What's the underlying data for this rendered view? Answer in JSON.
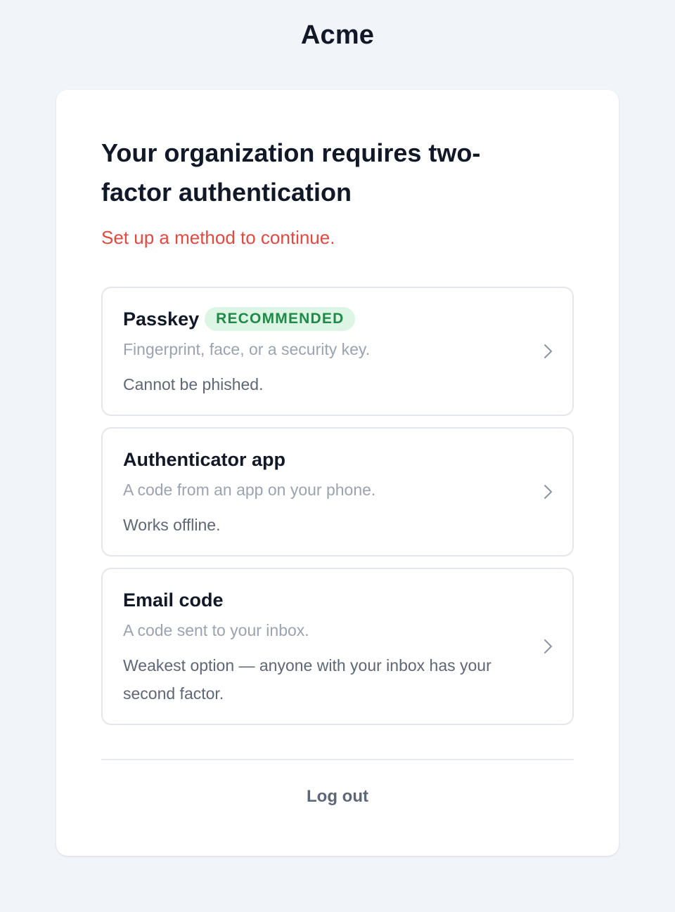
{
  "brand": {
    "name": "Acme"
  },
  "card": {
    "title": "Your organization requires two-factor authentication",
    "subtitle": "Set up a method to continue.",
    "subtitle_color": "#e5483f"
  },
  "methods": [
    {
      "name": "Passkey",
      "badge": "RECOMMENDED",
      "description": "Fingerprint, face, or a security key.",
      "note": "Cannot be phished.",
      "icon": "chevron-right-icon"
    },
    {
      "name": "Authenticator app",
      "description": "A code from an app on your phone.",
      "note": "Works offline.",
      "icon": "chevron-right-icon"
    },
    {
      "name": "Email code",
      "description": "A code sent to your inbox.",
      "note": "Weakest option — anyone with your inbox has your second factor.",
      "icon": "chevron-right-icon"
    }
  ],
  "footer": {
    "logout_label": "Log out"
  },
  "colors": {
    "background": "#f1f4f9",
    "badge_bg": "#dcf5e4",
    "badge_text": "#1f8a47"
  }
}
